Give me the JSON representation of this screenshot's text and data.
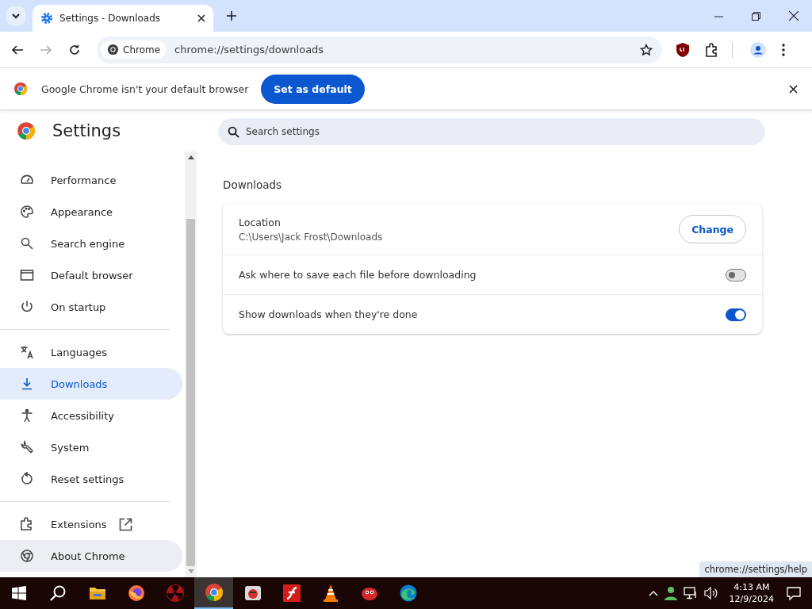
{
  "tab": {
    "title": "Settings - Downloads",
    "selected": true
  },
  "toolbar": {
    "chip": "Chrome",
    "url": "chrome://settings/downloads"
  },
  "infobar": {
    "message": "Google Chrome isn't your default browser",
    "button": "Set as default"
  },
  "settings": {
    "title": "Settings",
    "search": {
      "placeholder": "Search settings"
    }
  },
  "sidebar": {
    "groups": [
      [
        {
          "label": "Performance",
          "kind": "gauge",
          "selected": false
        },
        {
          "label": "Appearance",
          "kind": "palette",
          "selected": false
        },
        {
          "label": "Search engine",
          "kind": "search",
          "selected": false
        },
        {
          "label": "Default browser",
          "kind": "window",
          "selected": false
        },
        {
          "label": "On startup",
          "kind": "power",
          "selected": false
        }
      ],
      [
        {
          "label": "Languages",
          "kind": "translate",
          "selected": false
        },
        {
          "label": "Downloads",
          "kind": "download",
          "selected": true
        },
        {
          "label": "Accessibility",
          "kind": "person",
          "selected": false
        },
        {
          "label": "System",
          "kind": "wrench",
          "selected": false
        },
        {
          "label": "Reset settings",
          "kind": "reset",
          "selected": false
        }
      ],
      [
        {
          "label": "Extensions",
          "kind": "puzzle",
          "selected": false
        },
        {
          "label": "About Chrome",
          "kind": "chrome",
          "selected": false,
          "hovered": true
        }
      ]
    ]
  },
  "section": {
    "title": "Downloads",
    "location": {
      "label": "Location",
      "path": "C:\\Users\\Jack Frost\\Downloads",
      "button": "Change"
    },
    "toggles": [
      {
        "label": "Ask where to save each file before downloading",
        "on": false
      },
      {
        "label": "Show downloads when they're done",
        "on": true
      }
    ]
  },
  "tooltip": "chrome://settings/help",
  "taskbar": {
    "apps": [
      {
        "kind": "folder",
        "active": false
      },
      {
        "kind": "firefox",
        "active": false
      },
      {
        "kind": "radiation",
        "active": false
      },
      {
        "kind": "chrome",
        "active": true
      },
      {
        "kind": "game",
        "active": false
      },
      {
        "kind": "flash",
        "active": false
      },
      {
        "kind": "cone",
        "active": false
      },
      {
        "kind": "redball",
        "active": false
      },
      {
        "kind": "edge",
        "active": false
      }
    ],
    "time": "4:13 AM",
    "date": "12/9/2024"
  }
}
